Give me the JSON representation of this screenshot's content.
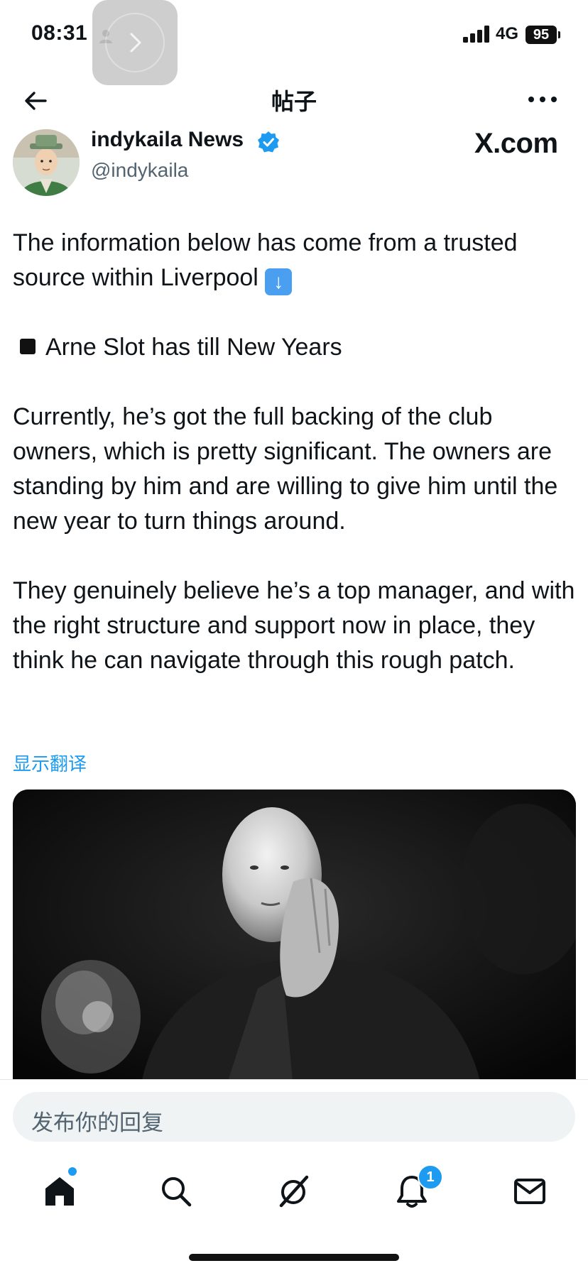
{
  "status_bar": {
    "time": "08:31",
    "network": "4G",
    "battery": "95"
  },
  "header": {
    "title": "帖子"
  },
  "post": {
    "author_name": "indykaila News",
    "author_handle": "@indykaila",
    "source_watermark": "X.com",
    "paragraphs": [
      "The information below has come from a trusted source within Liverpool",
      "Arne Slot has till New Years",
      "Currently, he’s got the full backing of the club owners, which is pretty significant. The owners are standing by him and are willing to give him until the new year to turn things around.",
      "They genuinely believe he’s a top manager, and with the right structure and support now in place, they think he can navigate through this rough patch."
    ],
    "translate_link": "显示翻译"
  },
  "reply": {
    "placeholder": "发布你的回复"
  },
  "nav": {
    "notifications_badge": "1"
  },
  "colors": {
    "accent": "#1d9bf0",
    "text": "#0f1419",
    "secondary_text": "#536471",
    "reply_bg": "#eff3f4"
  },
  "icons": [
    "back-arrow-icon",
    "more-icon",
    "verified-icon",
    "home-icon",
    "search-icon",
    "grok-icon",
    "bell-icon",
    "mail-icon"
  ]
}
